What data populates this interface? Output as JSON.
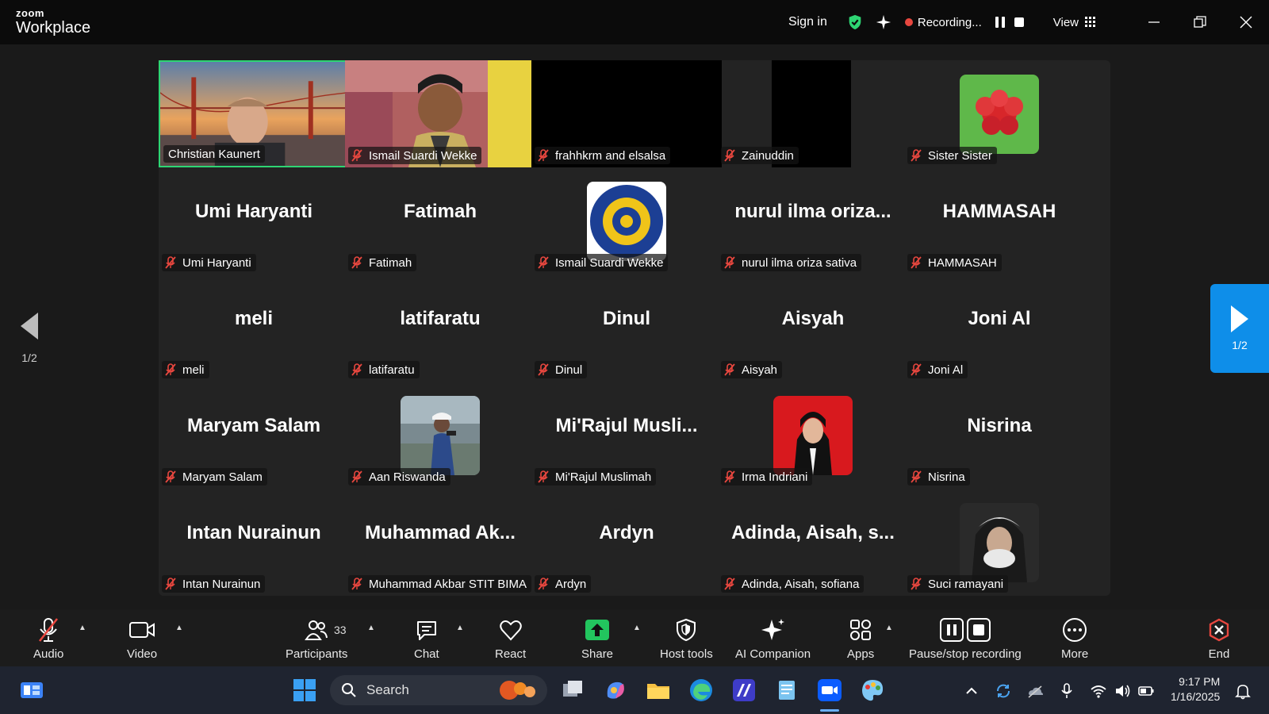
{
  "app": {
    "brand_top": "zoom",
    "brand_name": "Workplace"
  },
  "titlebar": {
    "signin": "Sign in",
    "recording": "Recording...",
    "view": "View"
  },
  "pager": {
    "left": "1/2",
    "right": "1/2"
  },
  "tiles": [
    {
      "display": "",
      "label": "Christian Kaunert",
      "muted": false
    },
    {
      "display": "",
      "label": "Ismail Suardi Wekke",
      "muted": true
    },
    {
      "display": "",
      "label": "frahhkrm and elsalsa",
      "muted": true
    },
    {
      "display": "",
      "label": "Zainuddin",
      "muted": true
    },
    {
      "display": "",
      "label": "Sister Sister",
      "muted": true
    },
    {
      "display": "Umi Haryanti",
      "label": "Umi Haryanti",
      "muted": true
    },
    {
      "display": "Fatimah",
      "label": "Fatimah",
      "muted": true
    },
    {
      "display": "",
      "label": "Ismail Suardi Wekke",
      "muted": true
    },
    {
      "display": "nurul ilma oriza...",
      "label": "nurul ilma oriza sativa",
      "muted": true
    },
    {
      "display": "HAMMASAH",
      "label": "HAMMASAH",
      "muted": true
    },
    {
      "display": "meli",
      "label": "meli",
      "muted": true
    },
    {
      "display": "latifaratu",
      "label": "latifaratu",
      "muted": true
    },
    {
      "display": "Dinul",
      "label": "Dinul",
      "muted": true
    },
    {
      "display": "Aisyah",
      "label": "Aisyah",
      "muted": true
    },
    {
      "display": "Joni Al",
      "label": "Joni Al",
      "muted": true
    },
    {
      "display": "Maryam Salam",
      "label": "Maryam Salam",
      "muted": true
    },
    {
      "display": "",
      "label": "Aan Riswanda",
      "muted": true
    },
    {
      "display": "Mi'Rajul Musli...",
      "label": "Mi'Rajul Muslimah",
      "muted": true
    },
    {
      "display": "",
      "label": "Irma Indriani",
      "muted": true
    },
    {
      "display": "Nisrina",
      "label": "Nisrina",
      "muted": true
    },
    {
      "display": "Intan Nurainun",
      "label": "Intan Nurainun",
      "muted": true
    },
    {
      "display": "Muhammad Ak...",
      "label": "Muhammad Akbar STIT BIMA",
      "muted": true
    },
    {
      "display": "Ardyn",
      "label": "Ardyn",
      "muted": true
    },
    {
      "display": "Adinda, Aisah, s...",
      "label": "Adinda, Aisah, sofiana",
      "muted": true
    },
    {
      "display": "",
      "label": "Suci ramayani",
      "muted": true
    }
  ],
  "toolbar": {
    "audio": "Audio",
    "video": "Video",
    "participants": "Participants",
    "participants_count": "33",
    "chat": "Chat",
    "react": "React",
    "share": "Share",
    "host_tools": "Host tools",
    "ai_companion": "AI Companion",
    "apps": "Apps",
    "pause_stop": "Pause/stop recording",
    "more": "More",
    "end": "End"
  },
  "taskbar": {
    "search": "Search",
    "time": "9:17 PM",
    "date": "1/16/2025"
  },
  "colors": {
    "active_border": "#2ed573",
    "share_green": "#22c55e",
    "accent_blue": "#0e8ee9",
    "mute_red": "#e8473f"
  }
}
